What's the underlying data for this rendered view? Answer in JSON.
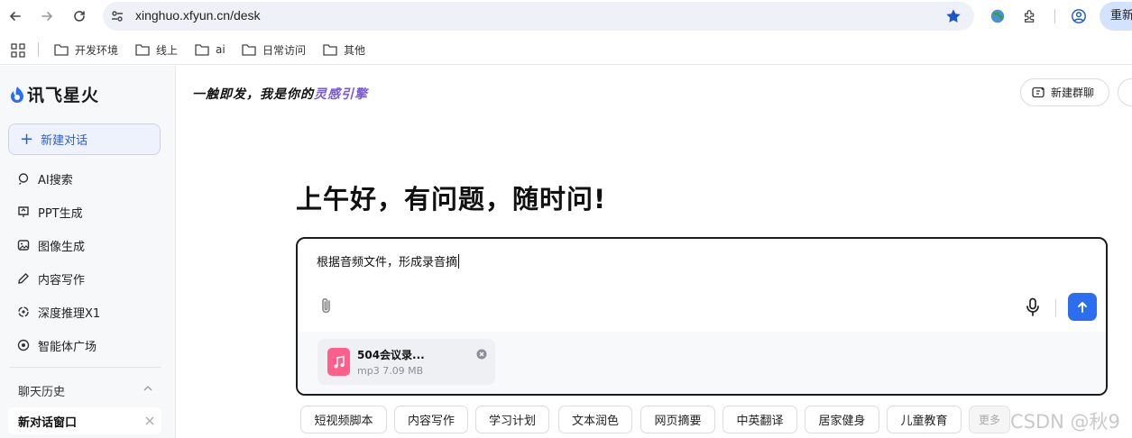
{
  "browser": {
    "url": "xinghuo.xfyun.cn/desk",
    "reload_label": "重新"
  },
  "bookmarks": [
    "开发环境",
    "线上",
    "ai",
    "日常访问",
    "其他"
  ],
  "sidebar": {
    "logo": "讯飞星火",
    "new_chat": "新建对话",
    "items": [
      {
        "label": "AI搜索",
        "icon": "search-icon"
      },
      {
        "label": "PPT生成",
        "icon": "ppt-icon"
      },
      {
        "label": "图像生成",
        "icon": "image-icon"
      },
      {
        "label": "内容写作",
        "icon": "pen-icon"
      },
      {
        "label": "深度推理X1",
        "icon": "reasoning-icon"
      },
      {
        "label": "智能体广场",
        "icon": "agent-icon"
      }
    ],
    "history_title": "聊天历史",
    "history_items": [
      "新对话窗口"
    ]
  },
  "header": {
    "slogan_prefix": "一触即发，我是你的",
    "slogan_highlight": "灵感引擎",
    "group_chat": "新建群聊"
  },
  "main": {
    "greeting": "上午好，有问题，随时问!",
    "input_value": "根据音频文件，形成录音摘",
    "attachment": {
      "name": "504会议录...",
      "meta": "mp3 7.09 MB"
    },
    "chips": [
      "短视频脚本",
      "内容写作",
      "学习计划",
      "文本润色",
      "网页摘要",
      "中英翻译",
      "居家健身",
      "儿童教育"
    ],
    "more": "更多"
  },
  "watermark": "CSDN @秋9",
  "colors": {
    "accent": "#2b6ef0",
    "file_icon": "#ff5f8a",
    "slogan_highlight": "#7a5bd0"
  }
}
